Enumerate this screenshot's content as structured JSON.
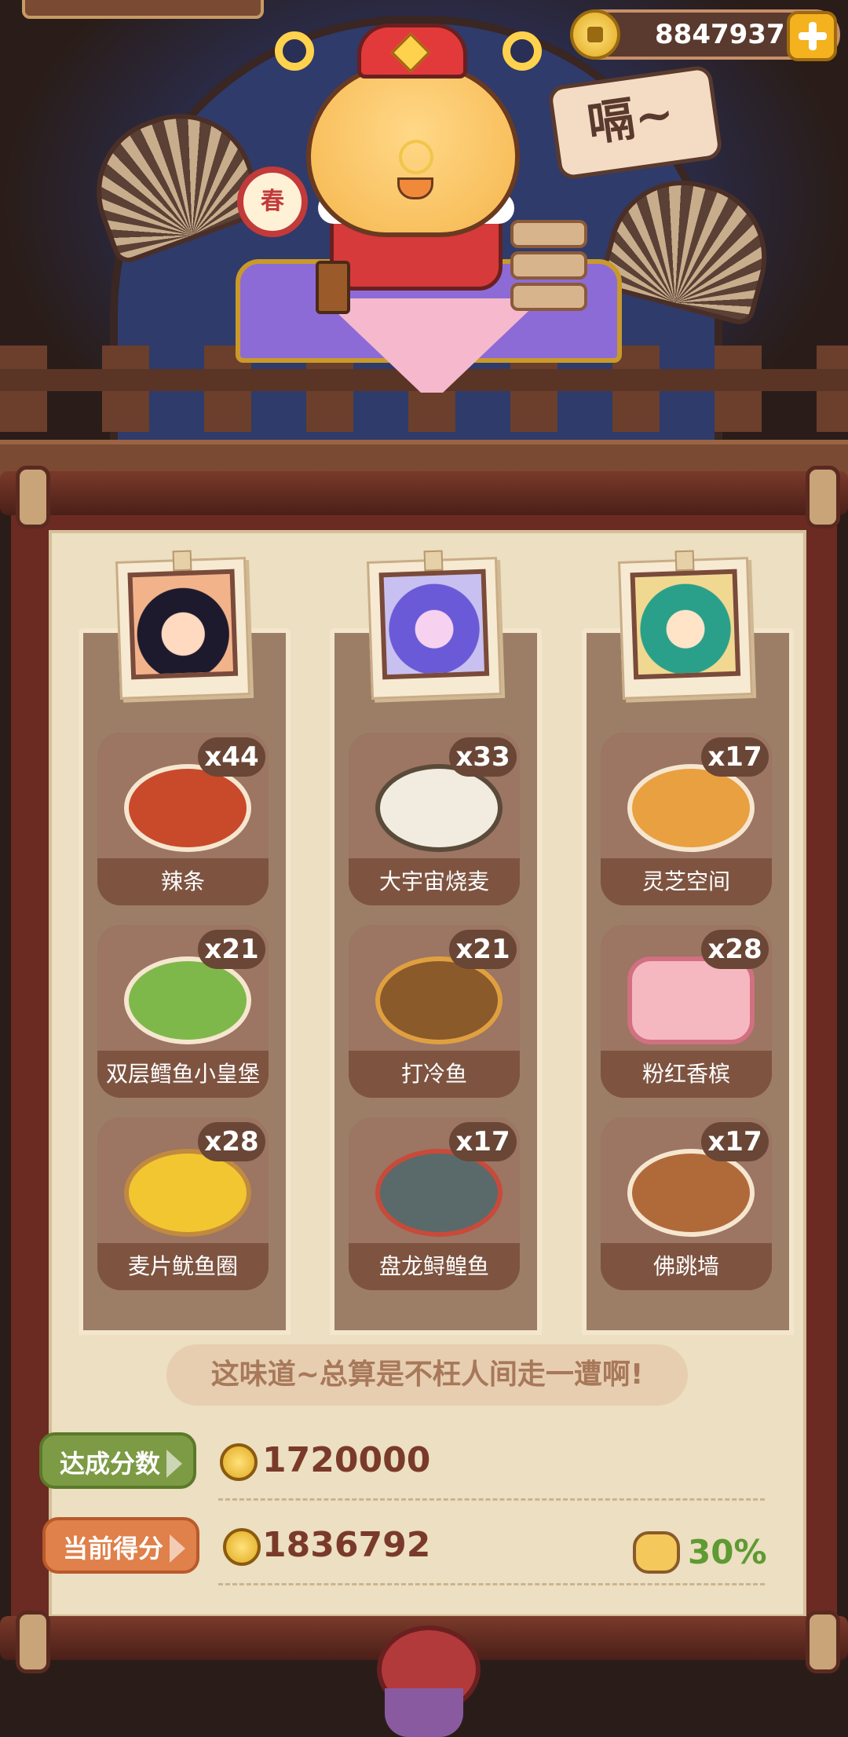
{
  "header": {
    "coins": "8847937",
    "speech": "嗝~",
    "drum_char": "春"
  },
  "customers": [
    {
      "name": "customer-1"
    },
    {
      "name": "customer-2"
    },
    {
      "name": "customer-3"
    }
  ],
  "dishes": [
    {
      "label": "辣条",
      "count": "x44"
    },
    {
      "label": "大宇宙烧麦",
      "count": "x33"
    },
    {
      "label": "灵芝空间",
      "count": "x17"
    },
    {
      "label": "双层鳕鱼小皇堡",
      "count": "x21"
    },
    {
      "label": "打冷鱼",
      "count": "x21"
    },
    {
      "label": "粉红香槟",
      "count": "x28"
    },
    {
      "label": "麦片鱿鱼圈",
      "count": "x28"
    },
    {
      "label": "盘龙鲟鳇鱼",
      "count": "x17"
    },
    {
      "label": "佛跳墙",
      "count": "x17"
    }
  ],
  "quote": "这味道~总算是不枉人间走一遭啊!",
  "score": {
    "target_label": "达成分数",
    "target_value": "1720000",
    "current_label": "当前得分",
    "current_value": "1836792",
    "bonus": "30%"
  },
  "colors": {
    "target_tag": "#7d9a45",
    "current_tag": "#e0804a",
    "bonus_text": "#5f9a32"
  }
}
